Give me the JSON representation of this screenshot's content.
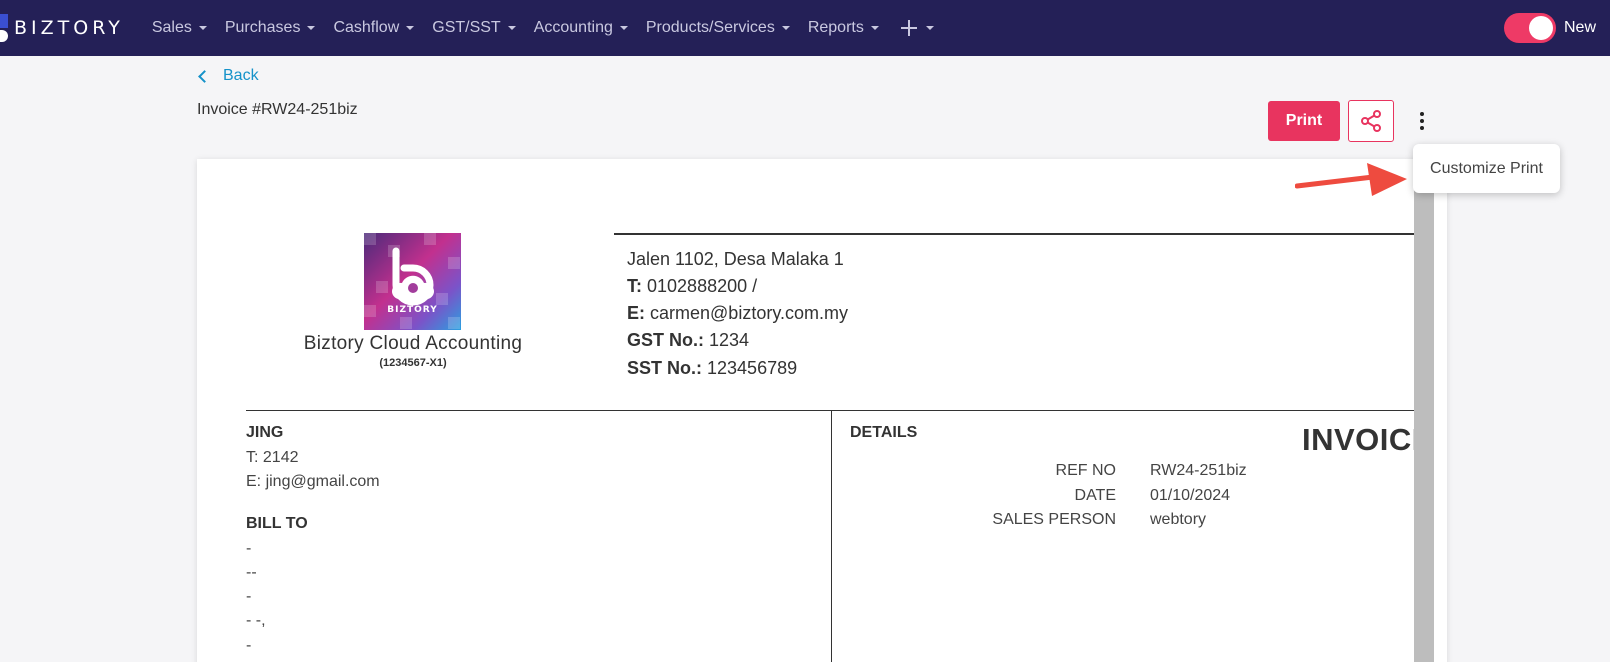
{
  "navbar": {
    "brand": "BIZTORY",
    "menu": [
      {
        "label": "Sales"
      },
      {
        "label": "Purchases"
      },
      {
        "label": "Cashflow"
      },
      {
        "label": "GST/SST"
      },
      {
        "label": "Accounting"
      },
      {
        "label": "Products/Services"
      },
      {
        "label": "Reports"
      }
    ],
    "plus_icon": "plus-icon",
    "toggle": {
      "label": "New",
      "on": true
    }
  },
  "page": {
    "back_label": "Back",
    "invoice_title": "Invoice #RW24-251biz",
    "print_label": "Print",
    "share_icon": "share-icon",
    "more_icon": "vertical-dots-icon",
    "popup_label": "Customize Print"
  },
  "company": {
    "logo_text": "BIZTORY",
    "name": "Biztory Cloud Accounting",
    "reg_no": "(1234567-X1)",
    "address": "Jalen 1102, Desa Malaka 1",
    "tel_label": "T:",
    "tel": "0102888200 /",
    "email_label": "E:",
    "email": "carmen@biztory.com.my",
    "gst_label": "GST No.:",
    "gst": "1234",
    "sst_label": "SST No.:",
    "sst": "123456789"
  },
  "customer": {
    "name": "JING",
    "tel": "T: 2142",
    "email": "E: jing@gmail.com",
    "bill_to_label": "BILL TO",
    "bill_lines": [
      "-",
      "--",
      "-",
      "- -,",
      "-"
    ]
  },
  "details": {
    "heading": "DETAILS",
    "doc_title": "INVOICE",
    "rows": [
      {
        "label": "REF NO",
        "value": "RW24-251biz"
      },
      {
        "label": "DATE",
        "value": "01/10/2024"
      },
      {
        "label": "SALES PERSON",
        "value": "webtory"
      }
    ]
  },
  "colors": {
    "navbar": "#242057",
    "accent": "#e8345f",
    "link": "#1592c9",
    "annotation_arrow": "#ee4b3f"
  }
}
